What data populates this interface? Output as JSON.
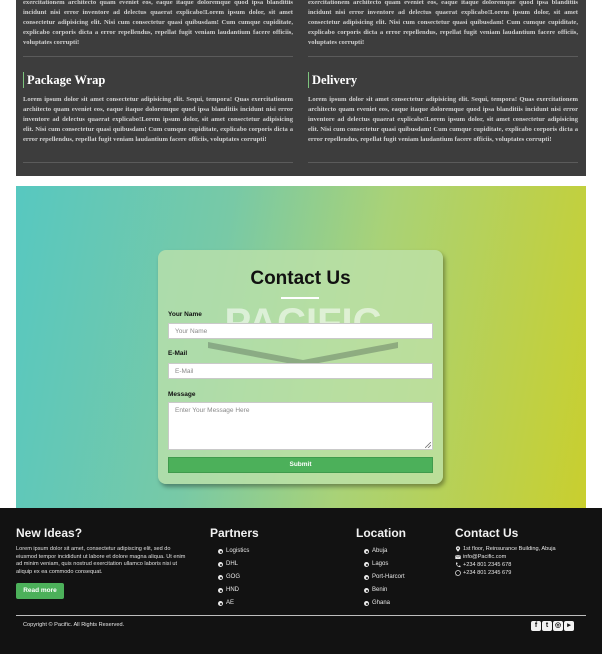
{
  "services": {
    "top_left_text": "exercitationem architecto quam eveniet eos, eaque itaque doloremque quod ipsa blanditiis incidunt nisi error inventore ad delectus quaerat explicabo!Lorem ipsum dolor, sit amet consectetur adipisicing elit. Nisi cum consectetur quasi quibusdam! Cum cumque cupiditate, explicabo corporis dicta a error repellendus, repellat fugit veniam laudantium facere officiis, voluptates corrupti!",
    "top_right_text": "exercitationem architecto quam eveniet eos, eaque itaque doloremque quod ipsa blanditiis incidunt nisi error inventore ad delectus quaerat explicabo!Lorem ipsum dolor, sit amet consectetur adipisicing elit. Nisi cum consectetur quasi quibusdam! Cum cumque cupiditate, explicabo corporis dicta a error repellendus, repellat fugit veniam laudantium facere officiis, voluptates corrupti!",
    "items": [
      {
        "title": "Package Wrap",
        "text": "Lorem ipsum dolor sit amet consectetur adipisicing elit. Sequi, tempora! Quas exercitationem architecto quam eveniet eos, eaque itaque doloremque quod ipsa blanditiis incidunt nisi error inventore ad delectus quaerat explicabo!Lorem ipsum dolor, sit amet consectetur adipisicing elit. Nisi cum consectetur quasi quibusdam! Cum cumque cupiditate, explicabo corporis dicta a error repellendus, repellat fugit veniam laudantium facere officiis, voluptates corrupti!"
      },
      {
        "title": "Delivery",
        "text": "Lorem ipsum dolor sit amet consectetur adipisicing elit. Sequi, tempora! Quas exercitationem architecto quam eveniet eos, eaque itaque doloremque quod ipsa blanditiis incidunt nisi error inventore ad delectus quaerat explicabo!Lorem ipsum dolor, sit amet consectetur adipisicing elit. Nisi cum consectetur quasi quibusdam! Cum cumque cupiditate, explicabo corporis dicta a error repellendus, repellat fugit veniam laudantium facere officiis, voluptates corrupti!"
      }
    ]
  },
  "contact_form": {
    "title": "Contact Us",
    "watermark": "PACIFIC",
    "name_label": "Your Name",
    "name_placeholder": "Your Name",
    "email_label": "E-Mail",
    "email_placeholder": "E-Mail",
    "message_label": "Message",
    "message_placeholder": "Enter Your Message Here",
    "submit_label": "Submit"
  },
  "footer": {
    "new_ideas": {
      "heading": "New Ideas?",
      "text": "Lorem ipsum dolor sit amet, consectetur adipiscing elit, sed do eiusmod tempor incididunt ut labore et dolore magna aliqua. Ut enim ad minim veniam, quis nostrud exercitation ullamco laboris nisi ut aliquip ex ea commodo consequat.",
      "button_label": "Read more"
    },
    "partners": {
      "heading": "Partners",
      "items": [
        "Logistics",
        "DHL",
        "GOG",
        "HND",
        "AE"
      ]
    },
    "location": {
      "heading": "Location",
      "items": [
        "Abuja",
        "Lagos",
        "Port-Harcort",
        "Benin",
        "Ghana"
      ]
    },
    "contact": {
      "heading": "Contact Us",
      "address": "1st floor, Reinsurance Building, Abuja",
      "email": "info@Pacific.com",
      "phone": "+234 801 2345 678",
      "whatsapp": "+234 801 2345 679"
    },
    "copyright": "Copyright © Pacific. All Rights Reserved.",
    "social_icons": [
      "facebook-icon",
      "twitter-icon",
      "instagram-icon",
      "youtube-icon"
    ]
  },
  "colors": {
    "accent_green": "#4cb05a",
    "dark_section": "#3d3d3d",
    "footer_bg": "#121212"
  }
}
